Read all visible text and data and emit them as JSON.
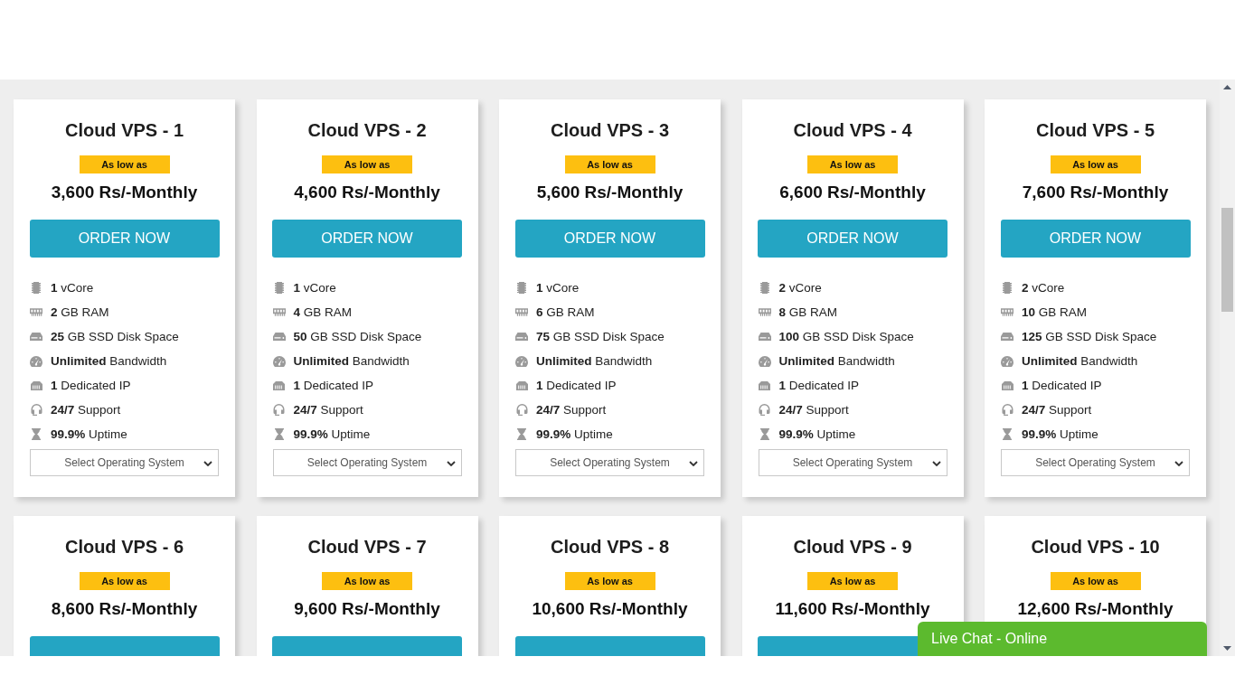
{
  "plans": [
    {
      "title": "Cloud VPS - 1",
      "badge": "As low as",
      "price": "3,600 Rs/-Monthly",
      "button": "ORDER NOW",
      "features": [
        {
          "kind": "cpu",
          "text": "**1** vCore"
        },
        {
          "kind": "ram",
          "text": "**2** GB RAM"
        },
        {
          "kind": "disk",
          "text": "**25** GB SSD Disk Space"
        },
        {
          "kind": "bandwidth",
          "text": "**Unlimited** Bandwidth"
        },
        {
          "kind": "ip",
          "text": "**1** Dedicated IP"
        },
        {
          "kind": "support",
          "text": "**24/7** Support"
        },
        {
          "kind": "uptime",
          "text": "**99.9%** Uptime"
        }
      ],
      "os_select": {
        "placeholder": "Select Operating System"
      }
    },
    {
      "title": "Cloud VPS - 2",
      "badge": "As low as",
      "price": "4,600 Rs/-Monthly",
      "button": "ORDER NOW",
      "features": [
        {
          "kind": "cpu",
          "text": "**1** vCore"
        },
        {
          "kind": "ram",
          "text": "**4** GB RAM"
        },
        {
          "kind": "disk",
          "text": "**50** GB SSD Disk Space"
        },
        {
          "kind": "bandwidth",
          "text": "**Unlimited** Bandwidth"
        },
        {
          "kind": "ip",
          "text": "**1** Dedicated IP"
        },
        {
          "kind": "support",
          "text": "**24/7** Support"
        },
        {
          "kind": "uptime",
          "text": "**99.9%** Uptime"
        }
      ],
      "os_select": {
        "placeholder": "Select Operating System"
      }
    },
    {
      "title": "Cloud VPS - 3",
      "badge": "As low as",
      "price": "5,600 Rs/-Monthly",
      "button": "ORDER NOW",
      "features": [
        {
          "kind": "cpu",
          "text": "**1** vCore"
        },
        {
          "kind": "ram",
          "text": "**6** GB RAM"
        },
        {
          "kind": "disk",
          "text": "**75** GB SSD Disk Space"
        },
        {
          "kind": "bandwidth",
          "text": "**Unlimited** Bandwidth"
        },
        {
          "kind": "ip",
          "text": "**1** Dedicated IP"
        },
        {
          "kind": "support",
          "text": "**24/7** Support"
        },
        {
          "kind": "uptime",
          "text": "**99.9%** Uptime"
        }
      ],
      "os_select": {
        "placeholder": "Select Operating System"
      }
    },
    {
      "title": "Cloud VPS - 4",
      "badge": "As low as",
      "price": "6,600 Rs/-Monthly",
      "button": "ORDER NOW",
      "features": [
        {
          "kind": "cpu",
          "text": "**2** vCore"
        },
        {
          "kind": "ram",
          "text": "**8** GB RAM"
        },
        {
          "kind": "disk",
          "text": "**100** GB SSD Disk Space"
        },
        {
          "kind": "bandwidth",
          "text": "**Unlimited** Bandwidth"
        },
        {
          "kind": "ip",
          "text": "**1** Dedicated IP"
        },
        {
          "kind": "support",
          "text": "**24/7** Support"
        },
        {
          "kind": "uptime",
          "text": "**99.9%** Uptime"
        }
      ],
      "os_select": {
        "placeholder": "Select Operating System"
      }
    },
    {
      "title": "Cloud VPS - 5",
      "badge": "As low as",
      "price": "7,600 Rs/-Monthly",
      "button": "ORDER NOW",
      "features": [
        {
          "kind": "cpu",
          "text": "**2** vCore"
        },
        {
          "kind": "ram",
          "text": "**10** GB RAM"
        },
        {
          "kind": "disk",
          "text": "**125** GB SSD Disk Space"
        },
        {
          "kind": "bandwidth",
          "text": "**Unlimited** Bandwidth"
        },
        {
          "kind": "ip",
          "text": "**1** Dedicated IP"
        },
        {
          "kind": "support",
          "text": "**24/7** Support"
        },
        {
          "kind": "uptime",
          "text": "**99.9%** Uptime"
        }
      ],
      "os_select": {
        "placeholder": "Select Operating System"
      }
    },
    {
      "title": "Cloud VPS - 6",
      "badge": "As low as",
      "price": "8,600 Rs/-Monthly",
      "button_cut": true
    },
    {
      "title": "Cloud VPS - 7",
      "badge": "As low as",
      "price": "9,600 Rs/-Monthly",
      "button_cut": true
    },
    {
      "title": "Cloud VPS - 8",
      "badge": "As low as",
      "price": "10,600 Rs/-Monthly",
      "button_cut": true
    },
    {
      "title": "Cloud VPS - 9",
      "badge": "As low as",
      "price": "11,600 Rs/-Monthly",
      "button_cut": true
    },
    {
      "title": "Cloud VPS - 10",
      "badge": "As low as",
      "price": "12,600 Rs/-Monthly"
    }
  ],
  "live_chat": {
    "label": "Live Chat - Online"
  }
}
